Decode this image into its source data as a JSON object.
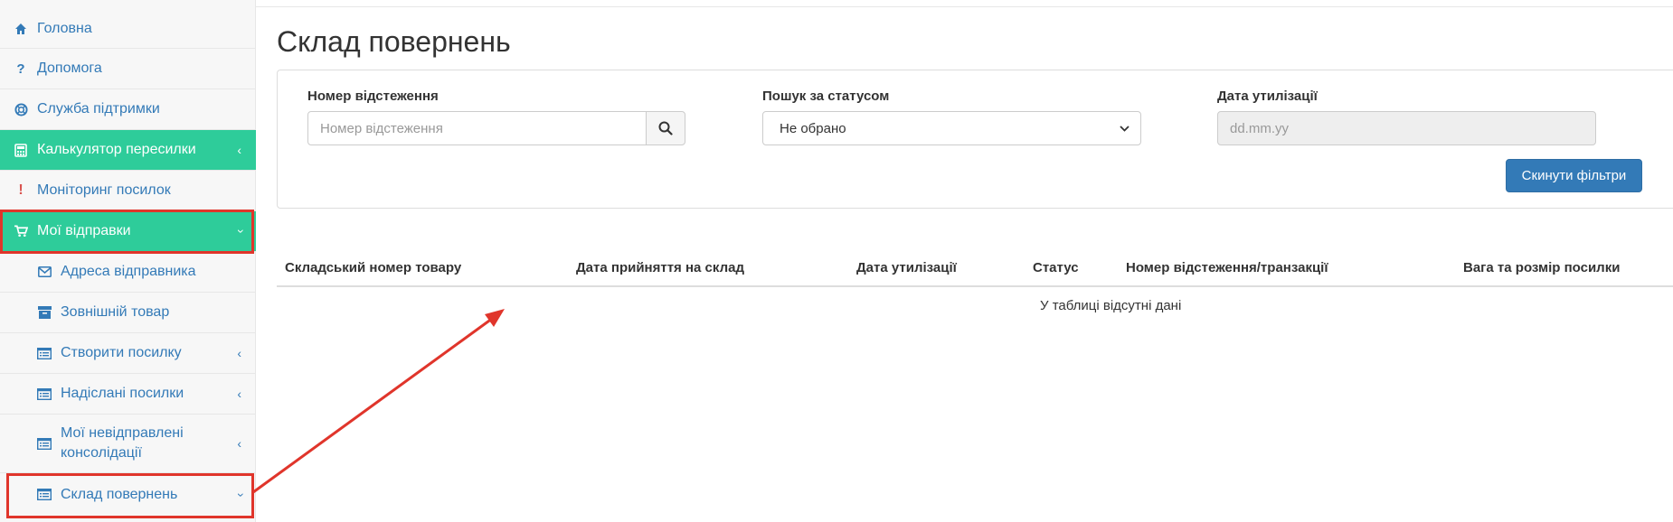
{
  "sidebar": {
    "items": [
      {
        "label": "Головна",
        "icon": "home-icon"
      },
      {
        "label": "Допомога",
        "icon": "question-icon"
      },
      {
        "label": "Служба підтримки",
        "icon": "lifebuoy-icon"
      },
      {
        "label": "Калькулятор пересилки",
        "icon": "calculator-icon"
      },
      {
        "label": "Моніторинг посилок",
        "icon": "exclamation-icon"
      },
      {
        "label": "Мої відправки",
        "icon": "cart-icon"
      },
      {
        "label": "Адреса відправника",
        "icon": "envelope-icon"
      },
      {
        "label": "Зовнішній товар",
        "icon": "archive-icon"
      },
      {
        "label": "Створити посилку",
        "icon": "list-icon"
      },
      {
        "label": "Надіслані посилки",
        "icon": "list-icon"
      },
      {
        "label": "Мої невідправлені консолідації",
        "icon": "list-icon"
      },
      {
        "label": "Склад повернень",
        "icon": "list-icon"
      }
    ]
  },
  "colors": {
    "accent": "#2ecc9a",
    "link": "#337ab7",
    "highlight": "#e0352b",
    "button": "#337ab7"
  },
  "page": {
    "title": "Склад повернень"
  },
  "filters": {
    "tracking_label": "Номер відстеження",
    "tracking_placeholder": "Номер відстеження",
    "status_label": "Пошук за статусом",
    "status_value": "Не обрано",
    "disposal_label": "Дата утилізації",
    "disposal_placeholder": "dd.mm.yy",
    "reset_label": "Скинути фільтри"
  },
  "table": {
    "columns": [
      "Складський номер товару",
      "Дата прийняття на склад",
      "Дата утилізації",
      "Статус",
      "Номер відстеження/транзакції",
      "Вага та розмір посилки"
    ],
    "empty_message": "У таблиці відсутні дані"
  }
}
